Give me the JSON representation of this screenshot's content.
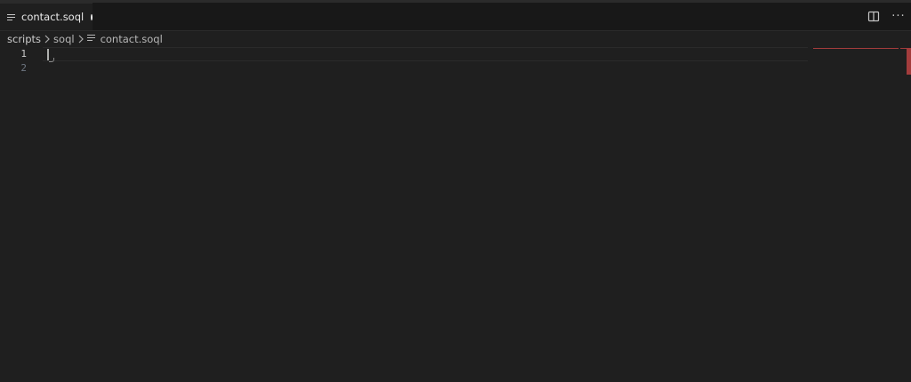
{
  "tab": {
    "label": "contact.soql",
    "modified": true,
    "icon": "lines-file-icon"
  },
  "tab_actions": {
    "split_icon": "split-editor-icon",
    "more_label": "···"
  },
  "breadcrumb": {
    "items": [
      "scripts",
      "soql",
      "contact.soql"
    ]
  },
  "editor": {
    "line_numbers": [
      "1",
      "2"
    ],
    "active_line": 1,
    "content": ""
  },
  "colors": {
    "background": "#1f1f1f",
    "tab_bar": "#181818",
    "scroll_marker": "#a33c3c",
    "line_number": "#6e7681",
    "active_line_number": "#cccccc"
  }
}
